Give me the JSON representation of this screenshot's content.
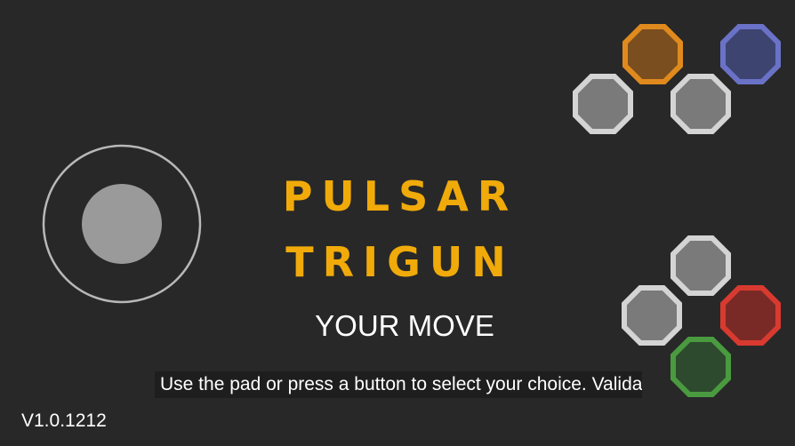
{
  "title": {
    "line1": "PULSAR",
    "line2": "TRIGUN"
  },
  "status_text": "YOUR MOVE",
  "instructions": "Use the pad or press a button to select your choice. Valida",
  "version": "V1.0.1212",
  "joystick": {
    "icon": "analog-stick-icon"
  },
  "buttons_top": [
    {
      "name": "orange-button",
      "color": "#e08a1e"
    },
    {
      "name": "blue-button",
      "color": "#6a72c8"
    },
    {
      "name": "left-gray-button",
      "color": "#d4d4d4"
    },
    {
      "name": "right-gray-button",
      "color": "#d4d4d4"
    }
  ],
  "buttons_bottom": [
    {
      "name": "top-gray-button",
      "color": "#d4d4d4"
    },
    {
      "name": "left-gray-button",
      "color": "#d4d4d4"
    },
    {
      "name": "red-button",
      "color": "#d83a30"
    },
    {
      "name": "green-button",
      "color": "#4a9a40"
    }
  ],
  "colors": {
    "background": "#282828",
    "title": "#f0aa0a",
    "button_fill_gray": "#7a7a7a",
    "orange_fill": "#7a4e1e",
    "blue_fill": "#3e4470",
    "red_fill": "#7a2a26",
    "green_fill": "#2e4a2e"
  }
}
